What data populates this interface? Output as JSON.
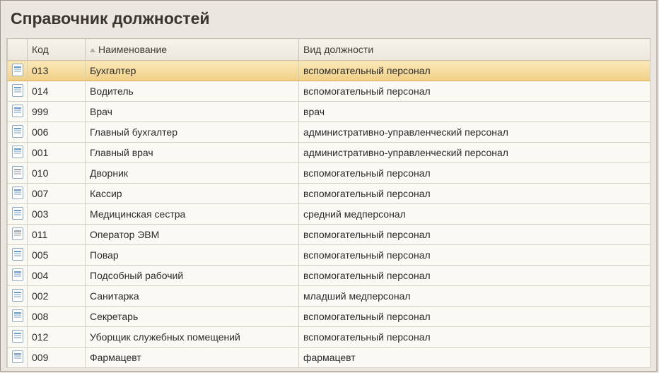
{
  "title": "Справочник должностей",
  "columns": {
    "icon": "",
    "code": "Код",
    "name": "Наименование",
    "type": "Вид должности"
  },
  "selected_index": 0,
  "rows": [
    {
      "code": "013",
      "name": "Бухгалтер",
      "type": "вспомогательный персонал",
      "alt": false
    },
    {
      "code": "014",
      "name": "Водитель",
      "type": "вспомогательный персонал",
      "alt": false
    },
    {
      "code": "999",
      "name": "Врач",
      "type": "врач",
      "alt": false
    },
    {
      "code": "006",
      "name": "Главный бухгалтер",
      "type": "административно-управленческий персонал",
      "alt": false
    },
    {
      "code": "001",
      "name": "Главный врач",
      "type": "административно-управленческий персонал",
      "alt": false
    },
    {
      "code": "010",
      "name": "Дворник",
      "type": "вспомогательный персонал",
      "alt": true
    },
    {
      "code": "007",
      "name": "Кассир",
      "type": "вспомогательный персонал",
      "alt": false
    },
    {
      "code": "003",
      "name": "Медицинская сестра",
      "type": "средний медперсонал",
      "alt": false
    },
    {
      "code": "011",
      "name": "Оператор ЭВМ",
      "type": "вспомогательный персонал",
      "alt": true
    },
    {
      "code": "005",
      "name": "Повар",
      "type": "вспомогательный персонал",
      "alt": false
    },
    {
      "code": "004",
      "name": "Подсобный рабочий",
      "type": "вспомогательный персонал",
      "alt": false
    },
    {
      "code": "002",
      "name": "Санитарка",
      "type": "младший медперсонал",
      "alt": false
    },
    {
      "code": "008",
      "name": "Секретарь",
      "type": "вспомогательный персонал",
      "alt": false
    },
    {
      "code": "012",
      "name": "Уборщик служебных помещений",
      "type": "вспомогательный персонал",
      "alt": false
    },
    {
      "code": "009",
      "name": "Фармацевт",
      "type": "фармацевт",
      "alt": false
    }
  ]
}
